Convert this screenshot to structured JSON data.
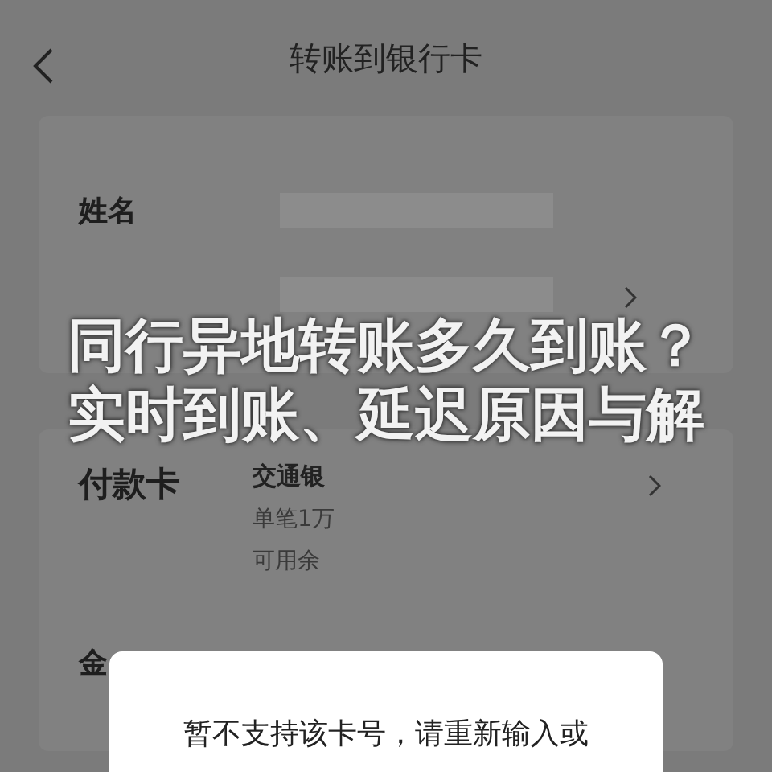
{
  "header": {
    "title": "转账到银行卡"
  },
  "payee_fields": [
    {
      "label": "姓名"
    }
  ],
  "payment": {
    "label": "付款卡",
    "bank": "交通银",
    "limit": "单笔1万",
    "balance": "可用余"
  },
  "amount": {
    "label": "金"
  },
  "dialog": {
    "message": "暂不支持该卡号，请重新输入或"
  },
  "headline": {
    "lines": [
      "同行异地转账多久到账？",
      "实时到账、延迟原因与解"
    ]
  }
}
